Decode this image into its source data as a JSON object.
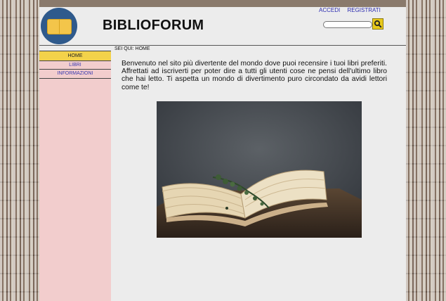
{
  "header": {
    "site_title": "BIBLIOFORUM",
    "top_links": {
      "login": "ACCEDI",
      "register": "REGISTRATI"
    },
    "search": {
      "placeholder": "",
      "value": ""
    }
  },
  "breadcrumb": "SEI QUI: HOME",
  "sidebar": {
    "items": [
      {
        "label": "HOME",
        "active": true
      },
      {
        "label": "LIBRI",
        "active": false
      },
      {
        "label": "INFORMAZIONI",
        "active": false
      }
    ]
  },
  "main": {
    "intro": "Benvenuto nel sito più divertente del mondo dove puoi recensire i tuoi libri preferiti. Affrettati ad iscriverti per poter dire a tutti gli utenti cose ne pensi dell'ultimo libro che hai letto. Ti aspetta un mondo di divertimento puro circondato da avidi lettori come te!"
  },
  "icons": {
    "logo": "open-book-icon",
    "search": "magnifier-icon"
  },
  "colors": {
    "sidebar_bg": "#f2cdcd",
    "active_nav": "#f3d24a",
    "link": "#3a3ab0",
    "search_button": "#e8c91b"
  }
}
